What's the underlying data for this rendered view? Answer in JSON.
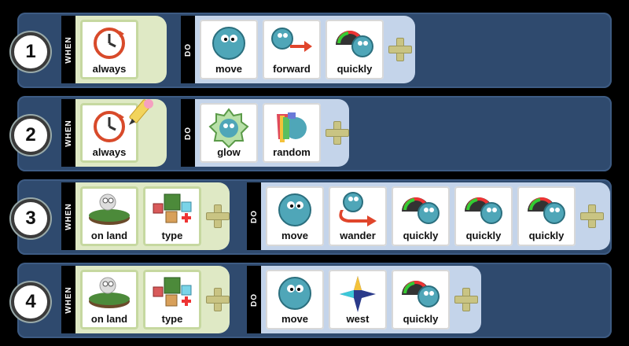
{
  "rows": [
    {
      "number": "1",
      "when_label": "WHEN",
      "do_label": "DO",
      "when": [
        {
          "icon": "clock-icon",
          "label": "always"
        }
      ],
      "do": [
        {
          "icon": "move-creature-icon",
          "label": "move"
        },
        {
          "icon": "forward-arrow-icon",
          "label": "forward"
        },
        {
          "icon": "speedometer-icon",
          "label": "quickly"
        }
      ]
    },
    {
      "number": "2",
      "when_label": "WHEN",
      "do_label": "DO",
      "when": [
        {
          "icon": "clock-icon",
          "label": "always"
        }
      ],
      "do": [
        {
          "icon": "glow-icon",
          "label": "glow"
        },
        {
          "icon": "paint-random-icon",
          "label": "random"
        }
      ]
    },
    {
      "number": "3",
      "when_label": "WHEN",
      "do_label": "DO",
      "when": [
        {
          "icon": "on-land-icon",
          "label": "on land"
        },
        {
          "icon": "type-blocks-icon",
          "label": "type"
        }
      ],
      "do": [
        {
          "icon": "move-creature-icon",
          "label": "move"
        },
        {
          "icon": "wander-arrow-icon",
          "label": "wander"
        },
        {
          "icon": "speedometer-icon",
          "label": "quickly"
        },
        {
          "icon": "speedometer-icon",
          "label": "quickly"
        },
        {
          "icon": "speedometer-icon",
          "label": "quickly"
        }
      ]
    },
    {
      "number": "4",
      "when_label": "WHEN",
      "do_label": "DO",
      "when": [
        {
          "icon": "on-land-icon",
          "label": "on land"
        },
        {
          "icon": "type-blocks-icon",
          "label": "type"
        }
      ],
      "do": [
        {
          "icon": "move-creature-icon",
          "label": "move"
        },
        {
          "icon": "compass-west-icon",
          "label": "west"
        },
        {
          "icon": "speedometer-icon",
          "label": "quickly"
        }
      ]
    }
  ],
  "colors": {
    "row_bg": "#2f4a6e",
    "when_bg": "#dfe9c5",
    "do_bg": "#c4d4ea",
    "plus": "#c9c483"
  }
}
